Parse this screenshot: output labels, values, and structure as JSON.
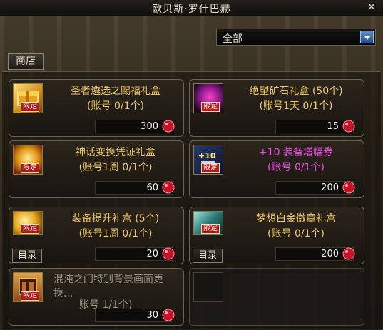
{
  "window": {
    "title": "欧贝斯·罗什巴赫"
  },
  "filter": {
    "selected": "全部"
  },
  "tab": {
    "label": "商店"
  },
  "items": [
    {
      "name": "圣者遴选之赐福礼盒",
      "limit": "(账号 0/1个)",
      "price": "300",
      "badge": "限定",
      "icon": "golden-box-icon",
      "has_catalog": false
    },
    {
      "name": "绝望矿石礼盒 (50个)",
      "limit": "(账号1天 0/1个)",
      "price": "15",
      "badge": "限定",
      "icon": "dark-ore-icon",
      "has_catalog": false
    },
    {
      "name": "神话变换凭证礼盒",
      "limit": "(账号1周 0/1个)",
      "price": "60",
      "badge": "限定",
      "icon": "myth-voucher-icon",
      "has_catalog": false
    },
    {
      "name": "+10 装备增幅券",
      "limit": "(账号 0/1个)",
      "price": "200",
      "badge": "限定",
      "icon": "amplify-ticket-icon",
      "has_catalog": false,
      "pink": true
    },
    {
      "name": "装备提升礼盒 (5个)",
      "limit": "(账号1周 0/1个)",
      "price": "20",
      "badge": "限定",
      "icon": "upgrade-box-icon",
      "has_catalog": true
    },
    {
      "name": "梦想白金徽章礼盒",
      "limit": "(账号 0/1个)",
      "price": "200",
      "badge": "限定",
      "icon": "platinum-emblem-icon",
      "has_catalog": true
    },
    {
      "name": "混沌之门特别背景画面更换...",
      "limit": "账号 1/1个)",
      "price": "30",
      "badge": "限定",
      "icon": "background-box-icon",
      "has_catalog": false,
      "dim": true
    }
  ],
  "catalog_label": "目录",
  "colors": {
    "gold_text": "#f0c968",
    "pink_text": "#f04ce8",
    "dim_text": "#9b9686"
  }
}
